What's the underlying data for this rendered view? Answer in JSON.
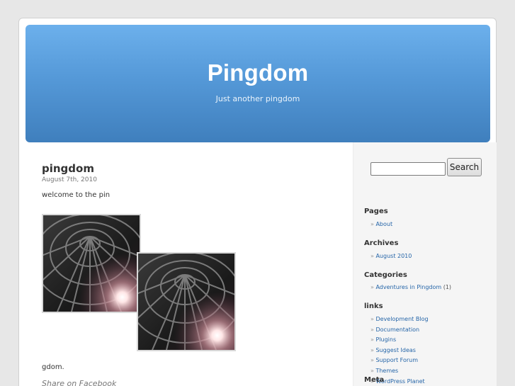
{
  "header": {
    "title": "Pingdom",
    "description": "Just another pingdom"
  },
  "post": {
    "title": "pingdom",
    "date": "August 7th, 2010",
    "text": "welcome to the pin",
    "tail_text": "gdom.",
    "share_link": "Share on Facebook",
    "images": [
      {
        "icon": "dome-ceiling-photo"
      },
      {
        "icon": "dome-ceiling-photo"
      }
    ]
  },
  "sidebar": {
    "search": {
      "placeholder": "",
      "value": "",
      "button_label": "Search"
    },
    "widgets": [
      {
        "title": "Pages",
        "items": [
          {
            "label": "About"
          }
        ]
      },
      {
        "title": "Archives",
        "items": [
          {
            "label": "August 2010"
          }
        ]
      },
      {
        "title": "Categories",
        "items": [
          {
            "label": "Adventures in Pingdom",
            "count": "(1)"
          }
        ]
      },
      {
        "title": "links",
        "items": [
          {
            "label": "Development Blog"
          },
          {
            "label": "Documentation"
          },
          {
            "label": "Plugins"
          },
          {
            "label": "Suggest Ideas"
          },
          {
            "label": "Support Forum"
          },
          {
            "label": "Themes"
          },
          {
            "label": "WordPress Planet"
          }
        ]
      },
      {
        "title": "Meta",
        "items": []
      }
    ],
    "bullet": "»"
  },
  "colors": {
    "header_top": "#6cb0ec",
    "header_bottom": "#3f7fbd",
    "link": "#2565a8",
    "page_bg": "#e7e7e7",
    "sidebar_bg": "#f5f5f5"
  }
}
